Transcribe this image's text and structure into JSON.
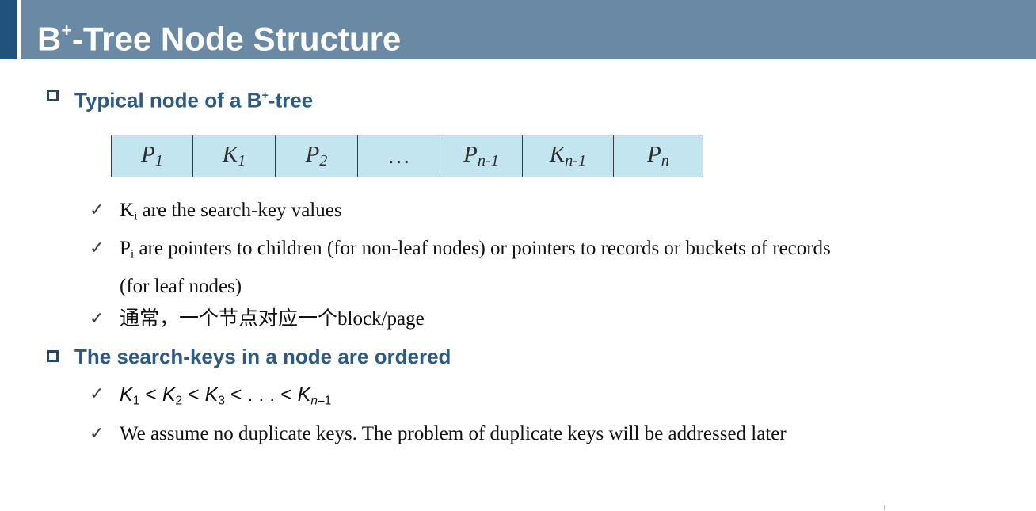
{
  "header": {
    "title_prefix": "B",
    "title_sup": "+",
    "title_suffix": "-Tree Node Structure"
  },
  "sections": [
    {
      "text_prefix": "Typical node of a B",
      "text_sup": "+",
      "text_suffix": "-tree"
    },
    {
      "text": "The search-keys in a node are ordered"
    }
  ],
  "node": {
    "cells": [
      {
        "base": "P",
        "sub": "1"
      },
      {
        "base": "K",
        "sub": "1"
      },
      {
        "base": "P",
        "sub": "2"
      },
      {
        "base": "…",
        "sub": ""
      },
      {
        "base": "P",
        "sub": "n-1"
      },
      {
        "base": "K",
        "sub": "n-1"
      },
      {
        "base": "P",
        "sub": "n"
      }
    ]
  },
  "bullets1": [
    {
      "lead": "K",
      "lead_sub": "i",
      "text": " are the search-key values"
    },
    {
      "lead": "P",
      "lead_sub": "i",
      "text": " are pointers to children (for non-leaf nodes) or pointers to records or buckets of records",
      "text_line2": "(for leaf nodes)"
    },
    {
      "text": "通常，一个节点对应一个block/page"
    }
  ],
  "bullets2": {
    "ordering": {
      "k1": "K",
      "s1": "1",
      "lt1": " < ",
      "k2": "K",
      "s2": "2",
      "lt2": " < ",
      "k3": "K",
      "s3": "3",
      "dots": " < . . . < ",
      "kn": "K",
      "sn": "n",
      "sn_tail": "–1"
    },
    "assumption": "We assume no duplicate keys. The problem of duplicate keys will be addressed later"
  },
  "check_glyph": "✓",
  "colors": {
    "title_bar": "#6a89a4",
    "title_accent": "#21527d",
    "section_text": "#2b5a84",
    "node_fill": "#c2e5f0"
  }
}
